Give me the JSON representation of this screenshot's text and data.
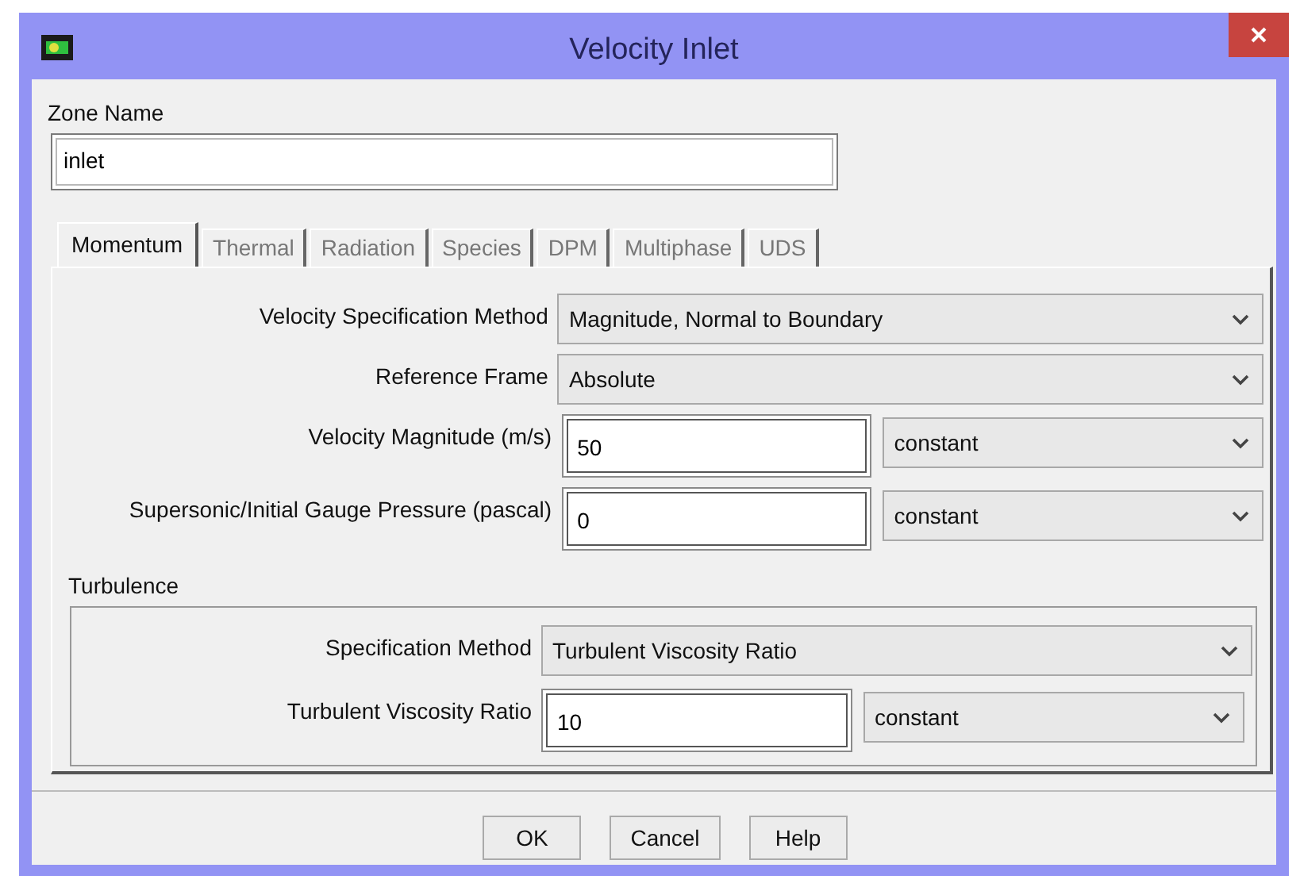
{
  "window": {
    "title": "Velocity Inlet"
  },
  "zone_name": {
    "label": "Zone Name",
    "value": "inlet"
  },
  "tabs": [
    {
      "label": "Momentum",
      "selected": true
    },
    {
      "label": "Thermal",
      "selected": false
    },
    {
      "label": "Radiation",
      "selected": false
    },
    {
      "label": "Species",
      "selected": false
    },
    {
      "label": "DPM",
      "selected": false
    },
    {
      "label": "Multiphase",
      "selected": false
    },
    {
      "label": "UDS",
      "selected": false
    }
  ],
  "fields": [
    {
      "kind": "dropdown",
      "label": "Velocity Specification Method",
      "value": "Magnitude, Normal to Boundary"
    },
    {
      "kind": "dropdown",
      "label": "Reference Frame",
      "value": "Absolute"
    },
    {
      "kind": "input",
      "label": "Velocity Magnitude (m/s)",
      "value": "50",
      "option": "constant"
    },
    {
      "kind": "input",
      "label": "Supersonic/Initial Gauge Pressure (pascal)",
      "value": "0",
      "option": "constant"
    }
  ],
  "turbulence": {
    "title": "Turbulence",
    "fields": [
      {
        "kind": "dropdown",
        "label": "Specification Method",
        "value": "Turbulent Viscosity Ratio"
      },
      {
        "kind": "input",
        "label": "Turbulent Viscosity Ratio",
        "value": "10",
        "option": "constant"
      }
    ]
  },
  "buttons": [
    "OK",
    "Cancel",
    "Help"
  ]
}
